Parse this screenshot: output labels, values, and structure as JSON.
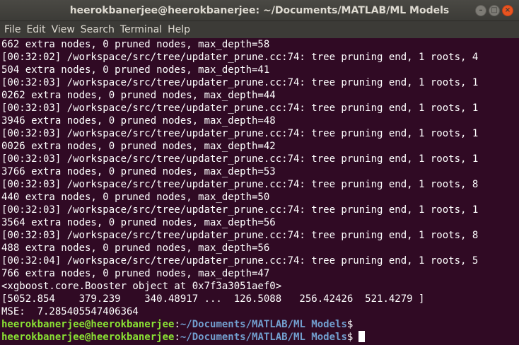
{
  "window": {
    "title": "heerokbanerjee@heerokbanerjee: ~/Documents/MATLAB/ML Models",
    "controls": {
      "minimize_glyph": "–",
      "maximize_glyph": "□",
      "close_glyph": "×"
    }
  },
  "menu": {
    "items": [
      "File",
      "Edit",
      "View",
      "Search",
      "Terminal",
      "Help"
    ]
  },
  "terminal": {
    "lines": [
      "662 extra nodes, 0 pruned nodes, max_depth=58",
      "[00:32:02] /workspace/src/tree/updater_prune.cc:74: tree pruning end, 1 roots, 4",
      "504 extra nodes, 0 pruned nodes, max_depth=41",
      "[00:32:03] /workspace/src/tree/updater_prune.cc:74: tree pruning end, 1 roots, 1",
      "0262 extra nodes, 0 pruned nodes, max_depth=44",
      "[00:32:03] /workspace/src/tree/updater_prune.cc:74: tree pruning end, 1 roots, 1",
      "3946 extra nodes, 0 pruned nodes, max_depth=48",
      "[00:32:03] /workspace/src/tree/updater_prune.cc:74: tree pruning end, 1 roots, 1",
      "0026 extra nodes, 0 pruned nodes, max_depth=42",
      "[00:32:03] /workspace/src/tree/updater_prune.cc:74: tree pruning end, 1 roots, 1",
      "3766 extra nodes, 0 pruned nodes, max_depth=53",
      "[00:32:03] /workspace/src/tree/updater_prune.cc:74: tree pruning end, 1 roots, 8",
      "440 extra nodes, 0 pruned nodes, max_depth=50",
      "[00:32:03] /workspace/src/tree/updater_prune.cc:74: tree pruning end, 1 roots, 1",
      "3564 extra nodes, 0 pruned nodes, max_depth=56",
      "[00:32:03] /workspace/src/tree/updater_prune.cc:74: tree pruning end, 1 roots, 8",
      "488 extra nodes, 0 pruned nodes, max_depth=56",
      "[00:32:04] /workspace/src/tree/updater_prune.cc:74: tree pruning end, 1 roots, 5",
      "766 extra nodes, 0 pruned nodes, max_depth=47",
      "<xgboost.core.Booster object at 0x7f3a3051aef0>",
      "[5052.854    379.239    340.48917 ...  126.5088   256.42426  521.4279 ]",
      "MSE:  7.285405547406364"
    ],
    "prompts": [
      {
        "user_host": "heerokbanerjee@heerokbanerjee",
        "separator": ":",
        "path": "~/Documents/MATLAB/ML Models",
        "symbol": "$"
      },
      {
        "user_host": "heerokbanerjee@heerokbanerjee",
        "separator": ":",
        "path": "~/Documents/MATLAB/ML Models",
        "symbol": "$"
      }
    ]
  },
  "colors": {
    "terminal_bg": "#300a24",
    "text": "#ffffff",
    "prompt_user": "#8ae234",
    "prompt_path": "#729fcf",
    "titlebar": "#3c3b37",
    "close_button": "#e95420"
  }
}
